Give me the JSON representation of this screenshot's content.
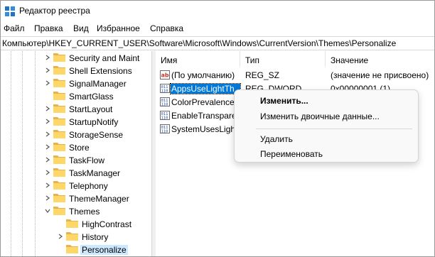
{
  "window": {
    "title": "Редактор реестра"
  },
  "menu": [
    "Файл",
    "Правка",
    "Вид",
    "Избранное",
    "Справка"
  ],
  "address": "Компьютер\\HKEY_CURRENT_USER\\Software\\Microsoft\\Windows\\CurrentVersion\\Themes\\Personalize",
  "tree": [
    {
      "label": "Security and Maint",
      "expand": "collapsed",
      "indent": 0
    },
    {
      "label": "Shell Extensions",
      "expand": "collapsed",
      "indent": 0
    },
    {
      "label": "SignalManager",
      "expand": "collapsed",
      "indent": 0
    },
    {
      "label": "SmartGlass",
      "expand": "none",
      "indent": 0
    },
    {
      "label": "StartLayout",
      "expand": "collapsed",
      "indent": 0
    },
    {
      "label": "StartupNotify",
      "expand": "collapsed",
      "indent": 0
    },
    {
      "label": "StorageSense",
      "expand": "collapsed",
      "indent": 0
    },
    {
      "label": "Store",
      "expand": "collapsed",
      "indent": 0
    },
    {
      "label": "TaskFlow",
      "expand": "collapsed",
      "indent": 0
    },
    {
      "label": "TaskManager",
      "expand": "collapsed",
      "indent": 0
    },
    {
      "label": "Telephony",
      "expand": "collapsed",
      "indent": 0
    },
    {
      "label": "ThemeManager",
      "expand": "collapsed",
      "indent": 0
    },
    {
      "label": "Themes",
      "expand": "expanded",
      "indent": 0
    },
    {
      "label": "HighContrast",
      "expand": "none",
      "indent": 1
    },
    {
      "label": "History",
      "expand": "collapsed",
      "indent": 1
    },
    {
      "label": "Personalize",
      "expand": "none",
      "indent": 1,
      "selected": true
    }
  ],
  "columns": {
    "name": "Имя",
    "type": "Тип",
    "data": "Значение"
  },
  "values": [
    {
      "name": "(По умолчанию)",
      "type": "REG_SZ",
      "data": "(значение не присвоено)",
      "icon": "string-value-icon"
    },
    {
      "name": "AppsUseLightTh",
      "type": "REG_DWORD",
      "data": "0x00000001 (1)",
      "icon": "dword-value-icon",
      "selected": true
    },
    {
      "name": "ColorPrevalence",
      "type": "",
      "data": "",
      "icon": "dword-value-icon"
    },
    {
      "name": "EnableTranspare",
      "type": "",
      "data": "",
      "icon": "dword-value-icon"
    },
    {
      "name": "SystemUsesLigh",
      "type": "",
      "data": "",
      "icon": "dword-value-icon"
    }
  ],
  "context_menu": {
    "modify": "Изменить...",
    "modify_binary": "Изменить двоичные данные...",
    "delete": "Удалить",
    "rename": "Переименовать"
  },
  "colors": {
    "selection": "#0078d7",
    "tree_selection": "#cce8ff",
    "folder": "#ffd769"
  }
}
